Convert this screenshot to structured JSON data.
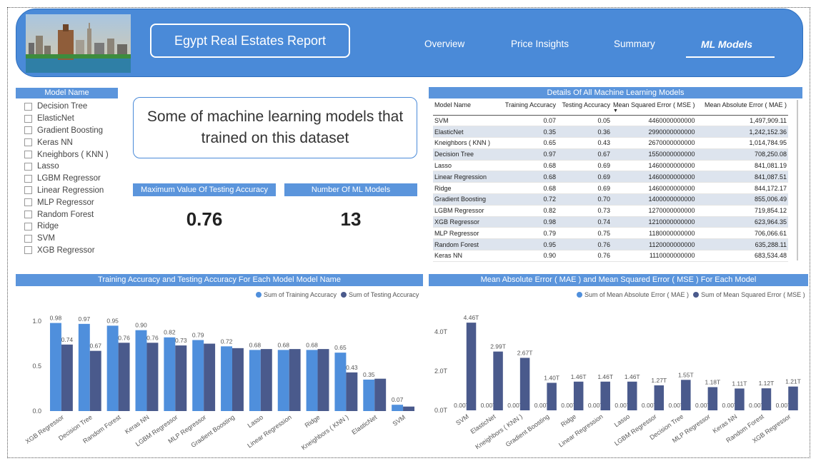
{
  "header": {
    "title": "Egypt Real Estates Report",
    "nav": [
      "Overview",
      "Price Insights",
      "Summary",
      "ML Models"
    ],
    "active": "ML Models"
  },
  "slicer": {
    "title": "Model Name",
    "items": [
      "Decision Tree",
      "ElasticNet",
      "Gradient Boosting",
      "Keras NN",
      "Kneighbors ( KNN )",
      "Lasso",
      "LGBM Regressor",
      "Linear Regression",
      "MLP Regressor",
      "Random Forest",
      "Ridge",
      "SVM",
      "XGB Regressor"
    ]
  },
  "textbox": "Some of machine learning models that trained on this dataset",
  "cards": [
    {
      "label": "Maximum Value Of Testing Accuracy",
      "value": "0.76"
    },
    {
      "label": "Number Of ML Models",
      "value": "13"
    }
  ],
  "table": {
    "title": "Details Of All Machine Learning Models",
    "columns": [
      "Model Name",
      "Training Accuracy",
      "Testing Accuracy",
      "Mean Squared Error ( MSE )",
      "Mean Absolute Error ( MAE )"
    ],
    "rows": [
      [
        "SVM",
        "0.07",
        "0.05",
        "4460000000000",
        "1,497,909.11"
      ],
      [
        "ElasticNet",
        "0.35",
        "0.36",
        "2990000000000",
        "1,242,152.36"
      ],
      [
        "Kneighbors ( KNN )",
        "0.65",
        "0.43",
        "2670000000000",
        "1,014,784.95"
      ],
      [
        "Decision Tree",
        "0.97",
        "0.67",
        "1550000000000",
        "708,250.08"
      ],
      [
        "Lasso",
        "0.68",
        "0.69",
        "1460000000000",
        "841,081.19"
      ],
      [
        "Linear Regression",
        "0.68",
        "0.69",
        "1460000000000",
        "841,087.51"
      ],
      [
        "Ridge",
        "0.68",
        "0.69",
        "1460000000000",
        "844,172.17"
      ],
      [
        "Gradient Boosting",
        "0.72",
        "0.70",
        "1400000000000",
        "855,006.49"
      ],
      [
        "LGBM Regressor",
        "0.82",
        "0.73",
        "1270000000000",
        "719,854.12"
      ],
      [
        "XGB Regressor",
        "0.98",
        "0.74",
        "1210000000000",
        "623,964.35"
      ],
      [
        "MLP Regressor",
        "0.79",
        "0.75",
        "1180000000000",
        "706,066.61"
      ],
      [
        "Random Forest",
        "0.95",
        "0.76",
        "1120000000000",
        "635,288.11"
      ],
      [
        "Keras NN",
        "0.90",
        "0.76",
        "1110000000000",
        "683,534.48"
      ]
    ]
  },
  "colors": {
    "primary": "#4a8ad8",
    "light": "#4f8fdc",
    "dark": "#4a5a8c"
  },
  "chart_data": [
    {
      "type": "bar",
      "title": "Training Accuracy and Testing Accuracy For Each Model Model Name",
      "categories": [
        "XGB Regressor",
        "Decision Tree",
        "Random Forest",
        "Keras NN",
        "LGBM Regressor",
        "MLP Regressor",
        "Gradient Boosting",
        "Lasso",
        "Linear Regression",
        "Ridge",
        "Kneighbors ( KNN )",
        "ElasticNet",
        "SVM"
      ],
      "series": [
        {
          "name": "Sum of Training Accuracy",
          "values": [
            0.98,
            0.97,
            0.95,
            0.9,
            0.82,
            0.79,
            0.72,
            0.68,
            0.68,
            0.68,
            0.65,
            0.35,
            0.07
          ],
          "labels": [
            "0.98",
            "0.97",
            "0.95",
            "0.90",
            "0.82",
            "0.79",
            "0.72",
            "0.68",
            "0.68",
            "0.68",
            "0.65",
            "0.35",
            "0.07"
          ]
        },
        {
          "name": "Sum of Testing Accuracy",
          "values": [
            0.74,
            0.67,
            0.76,
            0.76,
            0.73,
            0.75,
            0.7,
            0.69,
            0.69,
            0.69,
            0.43,
            0.36,
            0.05
          ],
          "labels": [
            "0.74",
            "0.67",
            "0.76",
            "0.76",
            "0.73",
            "",
            "",
            "",
            "",
            "",
            "0.43",
            "",
            ""
          ]
        }
      ],
      "yticks": [
        0,
        0.5,
        1.0
      ],
      "ytick_labels": [
        "0.0",
        "0.5",
        "1.0"
      ],
      "ylim": [
        0,
        1.08
      ],
      "legend": "top-right"
    },
    {
      "type": "bar",
      "title": "Mean Absolute Error ( MAE ) and Mean Squared Error ( MSE ) For Each Model",
      "categories": [
        "SVM",
        "ElasticNet",
        "Kneighbors ( KNN )",
        "Gradient Boosting",
        "Ridge",
        "Linear Regression",
        "Lasso",
        "LGBM Regressor",
        "Decision Tree",
        "MLP Regressor",
        "Keras NN",
        "Random Forest",
        "XGB Regressor"
      ],
      "series": [
        {
          "name": "Sum of Mean Absolute Error ( MAE )",
          "values": [
            1497909.11,
            1242152.36,
            1014784.95,
            855006.49,
            844172.17,
            841087.51,
            841081.19,
            719854.12,
            708250.08,
            706066.61,
            683534.48,
            635288.11,
            623964.35
          ],
          "labels": [
            "0.00T",
            "0.00T",
            "0.00T",
            "0.00T",
            "0.00T",
            "0.00T",
            "0.00T",
            "0.00T",
            "0.00T",
            "0.00T",
            "0.00T",
            "0.00T",
            "0.00T"
          ]
        },
        {
          "name": "Sum of Mean Squared Error ( MSE )",
          "values": [
            4460000000000,
            2990000000000,
            2670000000000,
            1400000000000,
            1460000000000,
            1460000000000,
            1460000000000,
            1270000000000,
            1550000000000,
            1180000000000,
            1110000000000,
            1120000000000,
            1210000000000
          ],
          "labels": [
            "4.46T",
            "2.99T",
            "2.67T",
            "1.40T",
            "1.46T",
            "1.46T",
            "1.46T",
            "1.27T",
            "1.55T",
            "1.18T",
            "1.11T",
            "1.12T",
            "1.21T"
          ]
        }
      ],
      "yticks": [
        0,
        2000000000000,
        4000000000000
      ],
      "ytick_labels": [
        "0.0T",
        "2.0T",
        "4.0T"
      ],
      "ylim": [
        0,
        4900000000000
      ],
      "legend": "top-right"
    }
  ]
}
